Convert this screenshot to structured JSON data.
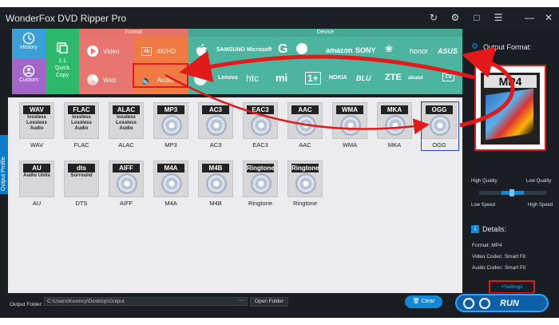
{
  "window": {
    "title": "WonderFox DVD Ripper Pro"
  },
  "left_tiles": {
    "history": "History",
    "custom": "Custom",
    "quick_copy_1": "1:1",
    "quick_copy_2": "Quick",
    "quick_copy_3": "Copy"
  },
  "categories": {
    "format": "Format",
    "device": "Device"
  },
  "format_buttons": {
    "video": "Video",
    "hd": "4K/HD",
    "web": "Web",
    "audio": "Audio"
  },
  "brands_row1": [
    "SAMSUNG",
    "Microsoft",
    "amazon",
    "SONY",
    "honor",
    "ASUS"
  ],
  "brands_row2": [
    "Lenovo",
    "htc",
    "mi",
    "1+",
    "NOKIA",
    "BLU",
    "ZTE",
    "alcatel",
    "TV"
  ],
  "side_tab": "Output Profile",
  "audio_formats_row1": [
    {
      "name": "WAV",
      "label": "WAV",
      "sub": "lossless Lossless Audio"
    },
    {
      "name": "FLAC",
      "label": "FLAC",
      "sub": "lossless Lossless Audio"
    },
    {
      "name": "ALAC",
      "label": "ALAC",
      "sub": "lossless Lossless Audio"
    },
    {
      "name": "MP3",
      "label": "MP3",
      "sub": ""
    },
    {
      "name": "AC3",
      "label": "AC3",
      "sub": ""
    },
    {
      "name": "EAC3",
      "label": "EAC3",
      "sub": ""
    },
    {
      "name": "AAC",
      "label": "AAC",
      "sub": ""
    },
    {
      "name": "WMA",
      "label": "WMA",
      "sub": ""
    },
    {
      "name": "MKA",
      "label": "MKA",
      "sub": ""
    },
    {
      "name": "OGG",
      "label": "OGG",
      "sub": ""
    }
  ],
  "audio_formats_row2": [
    {
      "name": "AU",
      "label": "AU",
      "sub": "Audio Units"
    },
    {
      "name": "dts",
      "label": "DTS",
      "sub": "Surround"
    },
    {
      "name": "AIFF",
      "label": "AIFF",
      "sub": ""
    },
    {
      "name": "M4A",
      "label": "M4A",
      "sub": ""
    },
    {
      "name": "M4B",
      "label": "M4B",
      "sub": ""
    },
    {
      "name": "Ringtone",
      "label": "Ringtone",
      "sub": ""
    },
    {
      "name": "Ringtone",
      "label": "Ringtone",
      "sub": ""
    }
  ],
  "right_panel": {
    "output_format_label": "Output Format:",
    "output_format_value": "MP4",
    "high_quality_left": "High Quality",
    "low_quality_right": "Low Quality",
    "low_speed": "Low Speed",
    "high_speed": "High Speed",
    "quality_level": 0.5,
    "details_label": "Details:",
    "format_detail": "Format: MP4",
    "video_codec": "Video Codec: Smart Fit",
    "audio_codec": "Audio Codec: Smart Fit",
    "settings": "Settings"
  },
  "bottom": {
    "output_folder_label": "Output Folder:",
    "output_folder_value": "C:\\Users\\Kevincy\\Desktop\\Output",
    "browse": "···",
    "open_folder": "Open Folder",
    "clear": "Clear",
    "run": "RUN"
  },
  "colors": {
    "format_red": "#e8756f",
    "format_orange": "#f07a44",
    "device_teal": "#4db59f",
    "history_blue": "#3aa0d8",
    "custom_purple": "#a365c7",
    "quick_copy_green": "#2db86b",
    "accent_blue": "#1389d6",
    "annotation_red": "#e21a1a"
  }
}
